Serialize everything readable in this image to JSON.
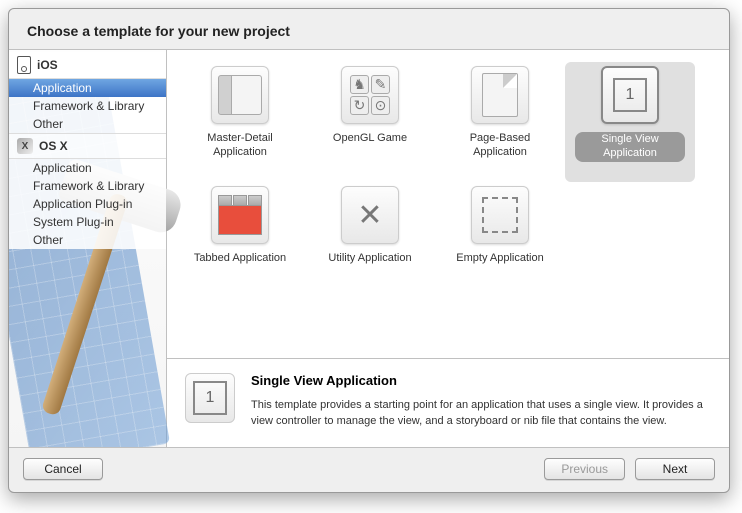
{
  "title": "Choose a template for your new project",
  "sidebar": {
    "groups": [
      {
        "label": "iOS",
        "icon": "device-icon",
        "items": [
          {
            "label": "Application",
            "selected": true
          },
          {
            "label": "Framework & Library",
            "selected": false
          },
          {
            "label": "Other",
            "selected": false
          }
        ]
      },
      {
        "label": "OS X",
        "icon": "osx-icon",
        "items": [
          {
            "label": "Application",
            "selected": false
          },
          {
            "label": "Framework & Library",
            "selected": false
          },
          {
            "label": "Application Plug-in",
            "selected": false
          },
          {
            "label": "System Plug-in",
            "selected": false
          },
          {
            "label": "Other",
            "selected": false
          }
        ]
      }
    ]
  },
  "templates": [
    {
      "label": "Master-Detail Application",
      "selected": false
    },
    {
      "label": "OpenGL Game",
      "selected": false
    },
    {
      "label": "Page-Based Application",
      "selected": false
    },
    {
      "label": "Single View Application",
      "selected": true
    },
    {
      "label": "Tabbed Application",
      "selected": false
    },
    {
      "label": "Utility Application",
      "selected": false
    },
    {
      "label": "Empty Application",
      "selected": false
    }
  ],
  "detail": {
    "title": "Single View Application",
    "desc": "This template provides a starting point for an application that uses a single view. It provides a view controller to manage the view, and a storyboard or nib file that contains the view."
  },
  "buttons": {
    "cancel": "Cancel",
    "previous": "Previous",
    "next": "Next",
    "previous_disabled": true
  }
}
